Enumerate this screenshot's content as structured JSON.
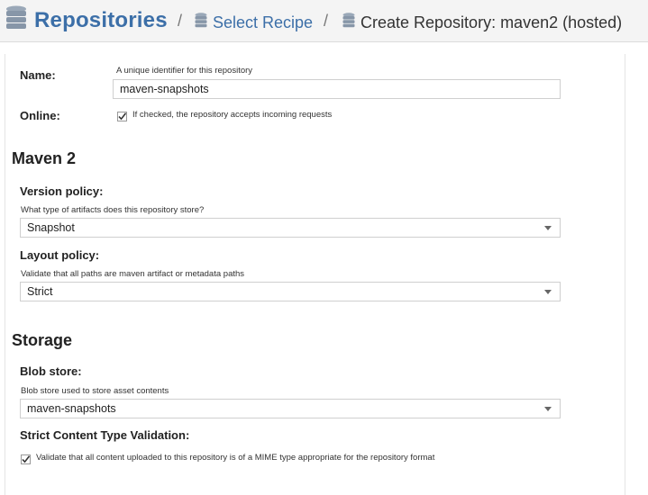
{
  "breadcrumb": {
    "root": "Repositories",
    "separator": "/",
    "recipe_link": "Select Recipe",
    "current": "Create Repository: maven2 (hosted)"
  },
  "form": {
    "name": {
      "label": "Name:",
      "help": "A unique identifier for this repository",
      "value": "maven-snapshots"
    },
    "online": {
      "label": "Online:",
      "checked": true,
      "text": "If checked, the repository accepts incoming requests"
    },
    "maven_section": "Maven 2",
    "version_policy": {
      "label": "Version policy:",
      "help": "What type of artifacts does this repository store?",
      "value": "Snapshot"
    },
    "layout_policy": {
      "label": "Layout policy:",
      "help": "Validate that all paths are maven artifact or metadata paths",
      "value": "Strict"
    },
    "storage_section": "Storage",
    "blob_store": {
      "label": "Blob store:",
      "help": "Blob store used to store asset contents",
      "value": "maven-snapshots"
    },
    "strict_content": {
      "label": "Strict Content Type Validation:",
      "checked": true,
      "text": "Validate that all content uploaded to this repository is of a MIME type appropriate for the repository format"
    }
  },
  "colors": {
    "link": "#3c6fa8",
    "header_bg": "#f4f4f4",
    "icon": "#8a9aab"
  }
}
